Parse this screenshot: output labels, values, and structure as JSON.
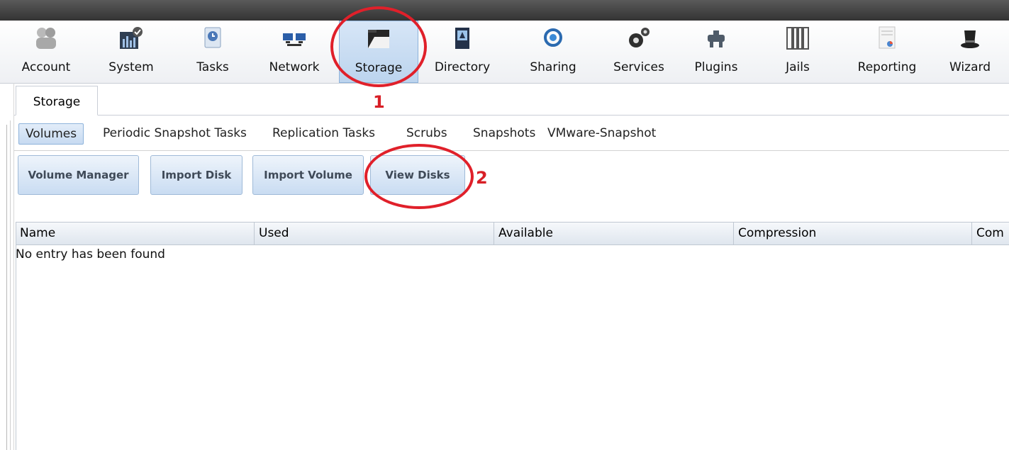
{
  "toolbar": {
    "items": [
      {
        "label": "Account",
        "icon": "account-icon"
      },
      {
        "label": "System",
        "icon": "system-icon"
      },
      {
        "label": "Tasks",
        "icon": "tasks-icon"
      },
      {
        "label": "Network",
        "icon": "network-icon"
      },
      {
        "label": "Storage",
        "icon": "storage-icon",
        "active": true
      },
      {
        "label": "Directory",
        "icon": "directory-icon"
      },
      {
        "label": "Sharing",
        "icon": "sharing-icon"
      },
      {
        "label": "Services",
        "icon": "services-icon"
      },
      {
        "label": "Plugins",
        "icon": "plugins-icon"
      },
      {
        "label": "Jails",
        "icon": "jails-icon"
      },
      {
        "label": "Reporting",
        "icon": "reporting-icon"
      },
      {
        "label": "Wizard",
        "icon": "wizard-icon"
      }
    ]
  },
  "main_tab": {
    "label": "Storage"
  },
  "subtabs": [
    {
      "label": "Volumes",
      "active": true
    },
    {
      "label": "Periodic Snapshot Tasks"
    },
    {
      "label": "Replication Tasks"
    },
    {
      "label": "Scrubs"
    },
    {
      "label": "Snapshots"
    },
    {
      "label": "VMware-Snapshot"
    }
  ],
  "actions": [
    {
      "label": "Volume Manager"
    },
    {
      "label": "Import Disk"
    },
    {
      "label": "Import Volume"
    },
    {
      "label": "View Disks"
    }
  ],
  "table": {
    "columns": [
      "Name",
      "Used",
      "Available",
      "Compression",
      "Com"
    ],
    "empty_message": "No entry has been found"
  },
  "annotations": {
    "step1": "1",
    "step2": "2"
  },
  "colors": {
    "annotation": "#d81f26",
    "active_bg": "#c7daf1",
    "topbar": "#3a3a3a"
  }
}
